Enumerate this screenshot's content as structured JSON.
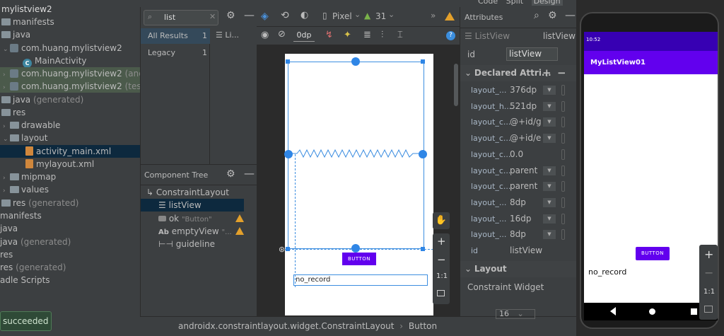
{
  "project": {
    "items": [
      {
        "label": "mylistview2",
        "dim": ""
      },
      {
        "label": "manifests",
        "dim": ""
      },
      {
        "label": "java",
        "dim": ""
      },
      {
        "label": "com.huang.mylistview2",
        "dim": ""
      },
      {
        "label": "MainActivity",
        "dim": ""
      },
      {
        "label": "com.huang.mylistview2",
        "dim": "(andro"
      },
      {
        "label": "com.huang.mylistview2",
        "dim": "(test)"
      },
      {
        "label": "java",
        "dim": "(generated)"
      },
      {
        "label": "res",
        "dim": ""
      },
      {
        "label": "drawable",
        "dim": ""
      },
      {
        "label": "layout",
        "dim": ""
      },
      {
        "label": "activity_main.xml",
        "dim": ""
      },
      {
        "label": "mylayout.xml",
        "dim": ""
      },
      {
        "label": "mipmap",
        "dim": ""
      },
      {
        "label": "values",
        "dim": ""
      },
      {
        "label": "res",
        "dim": "(generated)"
      },
      {
        "label": "manifests",
        "dim": ""
      },
      {
        "label": "java",
        "dim": ""
      },
      {
        "label": "java",
        "dim": "(generated)"
      },
      {
        "label": "res",
        "dim": ""
      },
      {
        "label": "res",
        "dim": "(generated)"
      },
      {
        "label": "adle Scripts",
        "dim": ""
      }
    ],
    "toast": "succeeded"
  },
  "palette": {
    "search_value": "list",
    "results_label": "All Results",
    "results_count": "1",
    "legacy_label": "Legacy",
    "legacy_count": "1",
    "list_item": "Li..."
  },
  "component_tree": {
    "title": "Component Tree",
    "items": [
      {
        "label": "ConstraintLayout",
        "sub": ""
      },
      {
        "label": "listView",
        "sub": ""
      },
      {
        "label": "ok",
        "sub": "\"Button\""
      },
      {
        "label": "emptyView",
        "sub": "\"..."
      },
      {
        "label": "guideline",
        "sub": ""
      }
    ]
  },
  "design_toolbar": {
    "device": "Pixel",
    "api": "31",
    "margin": "0dp"
  },
  "canvas": {
    "button_text": "BUTTON",
    "norecord_text": "no_record"
  },
  "zoom": {
    "plus": "+",
    "minus": "−",
    "ratio": "1:1"
  },
  "attributes": {
    "title": "Attributes",
    "component": "ListView",
    "component_id": "listView",
    "id_label": "id",
    "id_value": "listView",
    "declared_title": "Declared Attri...",
    "declared": [
      {
        "name": "layout_...",
        "value": "376dp",
        "dd": true
      },
      {
        "name": "layout_h...",
        "value": "521dp",
        "dd": true
      },
      {
        "name": "layout_c...",
        "value": "@+id/g",
        "dd": true
      },
      {
        "name": "layout_c...",
        "value": "@+id/e",
        "dd": true
      },
      {
        "name": "layout_c...",
        "value": "0.0",
        "dd": false
      },
      {
        "name": "layout_c...",
        "value": "parent",
        "dd": true
      },
      {
        "name": "layout_c...",
        "value": "parent",
        "dd": true
      },
      {
        "name": "layout_...",
        "value": "8dp",
        "dd": true
      },
      {
        "name": "layout_...",
        "value": "16dp",
        "dd": true
      },
      {
        "name": "layout_...",
        "value": "8dp",
        "dd": true
      },
      {
        "name": "id",
        "value": "listView",
        "dd": false
      }
    ],
    "layout_title": "Layout",
    "constraint_widget": "Constraint Widget",
    "bottom_value": "16"
  },
  "header_tabs": {
    "code": "Code",
    "split": "Split",
    "design": "Design"
  },
  "breadcrumb": {
    "path": "androidx.constraintlayout.widget.ConstraintLayout",
    "leaf": "Button"
  },
  "device": {
    "time": "10:52",
    "app_title": "MyListView01",
    "button_text": "BUTTON",
    "norecord_text": "no_record"
  }
}
